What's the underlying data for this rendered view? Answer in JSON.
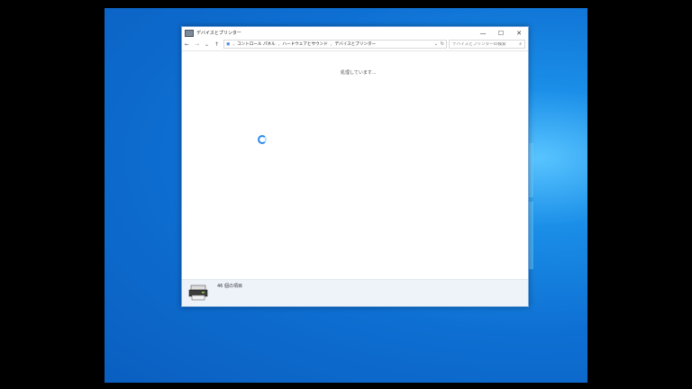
{
  "window": {
    "title": "デバイスとプリンター",
    "minimize": "—",
    "maximize": "☐",
    "close": "✕"
  },
  "nav": {
    "back": "←",
    "forward": "→",
    "history": "⌄",
    "up": "↑"
  },
  "breadcrumb": [
    "コントロール パネル",
    "ハードウェアとサウンド",
    "デバイスとプリンター"
  ],
  "search": {
    "placeholder": "デバイスとプリンターの検索"
  },
  "main": {
    "status": "処理しています..."
  },
  "status_bar": {
    "item_count": "46 個の項目"
  }
}
